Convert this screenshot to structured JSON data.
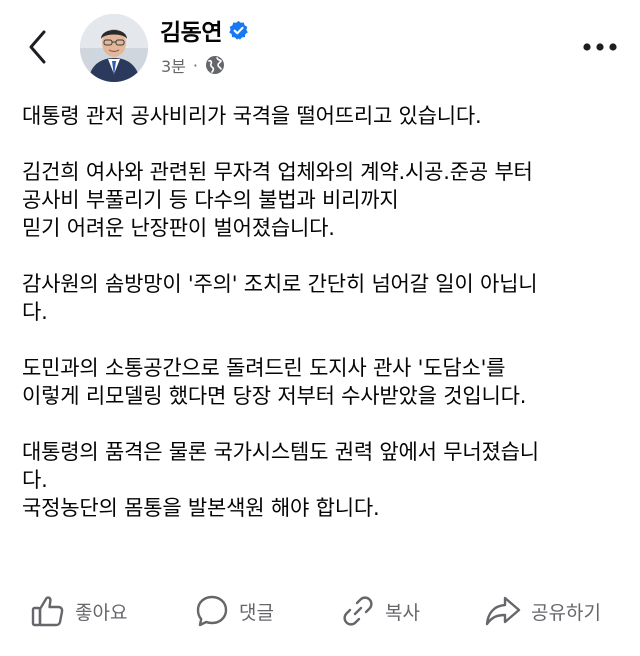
{
  "post": {
    "author": {
      "name": "김동연",
      "verified": true
    },
    "meta": {
      "time": "3분",
      "separator": "·",
      "audience_icon": "globe-icon"
    },
    "lines": [
      "대통령 관저 공사비리가 국격을 떨어뜨리고 있습니다.",
      "",
      "김건희 여사와 관련된 무자격 업체와의 계약.시공.준공 부터",
      "공사비 부풀리기 등 다수의 불법과 비리까지",
      "믿기 어려운 난장판이 벌어졌습니다.",
      "",
      "감사원의 솜방망이 '주의' 조치로 간단히 넘어갈 일이 아닙니",
      "다.",
      "",
      "도민과의 소통공간으로 돌려드린 도지사 관사 '도담소'를",
      "이렇게 리모델링 했다면 당장 저부터 수사받았을 것입니다.",
      "",
      "대통령의 품격은 물론 국가시스템도 권력 앞에서 무너졌습니",
      "다.",
      "국정농단의 몸통을 발본색원 해야 합니다."
    ]
  },
  "actions": {
    "like": "좋아요",
    "comment": "댓글",
    "share_copy": "복사",
    "share": "공유하기"
  },
  "colors": {
    "text": "#050505",
    "secondary": "#65676b",
    "verified": "#1877f2"
  }
}
